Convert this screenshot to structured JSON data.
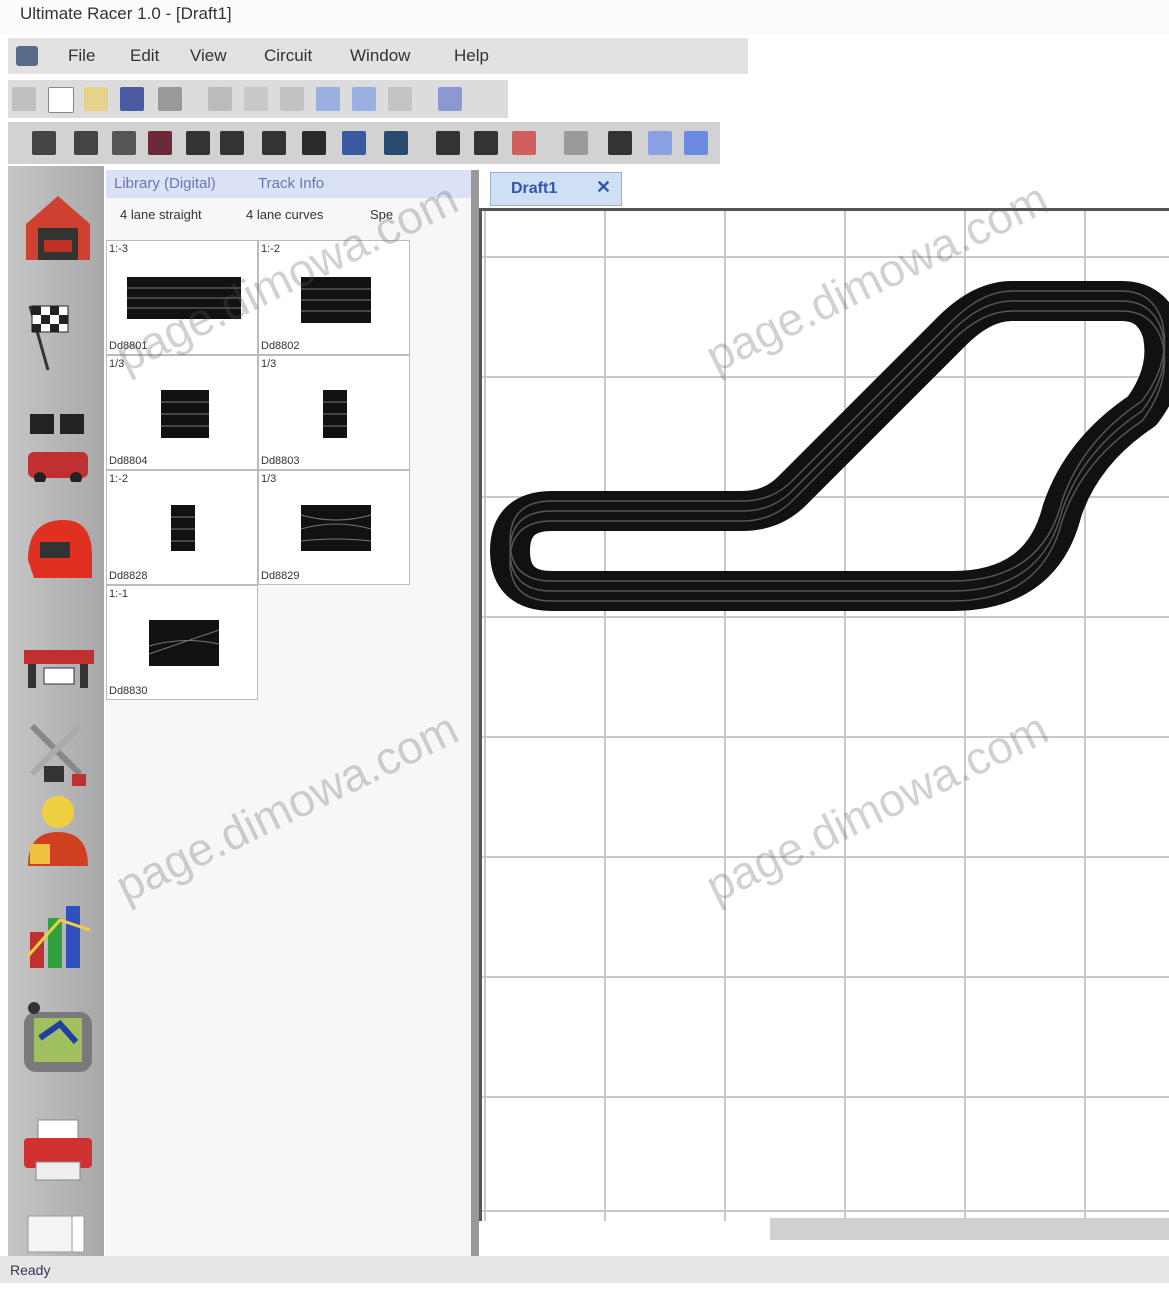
{
  "window": {
    "title": "Ultimate Racer 1.0 - [Draft1]"
  },
  "menu": [
    "File",
    "Edit",
    "View",
    "Circuit",
    "Window",
    "Help"
  ],
  "library": {
    "header": [
      "Library (Digital)",
      "Track Info"
    ],
    "tabs": [
      "4 lane straight",
      "4 lane curves",
      "Spe"
    ],
    "cells": [
      {
        "label": "1:-3",
        "code": "Dd8801"
      },
      {
        "label": "1:-2",
        "code": "Dd8802"
      },
      {
        "label": "1/3",
        "code": "Dd8804"
      },
      {
        "label": "1/3",
        "code": "Dd8803"
      },
      {
        "label": "1:-2",
        "code": "Dd8828"
      },
      {
        "label": "1/3",
        "code": "Dd8829"
      },
      {
        "label": "1:-1",
        "code": "Dd8830"
      }
    ]
  },
  "document": {
    "tab_label": "Draft1",
    "close_symbol": "✕"
  },
  "status": {
    "text": "Ready"
  },
  "watermark": "page.dimowa.com",
  "sidebar_icons": [
    "garage-icon",
    "checkered-flag-icon",
    "race-car-flags-icon",
    "helmet-icon",
    "grandstand-icon",
    "tools-icon",
    "driver-icon",
    "chart-icon",
    "track-map-icon",
    "printer-icon",
    "blank-page-icon"
  ],
  "toolbar1_icons": [
    "app-icon",
    "new-icon",
    "open-icon",
    "save-icon",
    "print-icon",
    "cut-icon",
    "copy-icon",
    "paste-icon",
    "undo-icon",
    "redo-icon",
    "zoom-icon",
    "help-icon"
  ],
  "toolbar2_icons": [
    "track-piece-1-icon",
    "track-piece-2-icon",
    "track-piece-3-icon",
    "track-piece-4-icon",
    "track-piece-5-icon",
    "track-piece-6-icon",
    "track-piece-7-icon",
    "track-piece-8-icon",
    "track-piece-9-icon",
    "track-piece-10-icon",
    "track-piece-11-icon",
    "track-piece-12-icon",
    "track-piece-13-icon",
    "track-piece-14-icon",
    "track-piece-15-icon",
    "track-piece-16-icon",
    "track-piece-17-icon"
  ]
}
